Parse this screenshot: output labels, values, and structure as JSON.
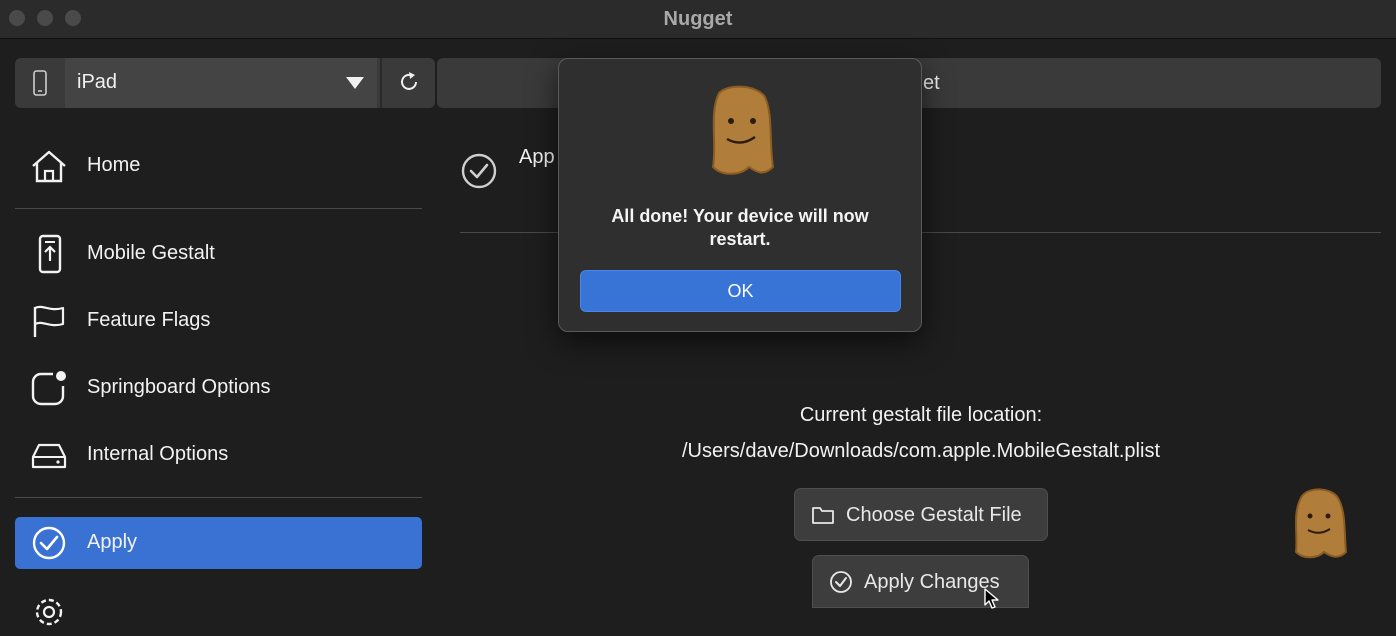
{
  "window": {
    "title": "Nugget"
  },
  "device_bar": {
    "selected_device": "iPad"
  },
  "top_field": {
    "text": "et"
  },
  "sidebar": {
    "items": [
      {
        "label": "Home",
        "icon": "home-icon"
      },
      {
        "label": "Mobile Gestalt",
        "icon": "phone-upload-icon"
      },
      {
        "label": "Feature Flags",
        "icon": "flag-icon"
      },
      {
        "label": "Springboard Options",
        "icon": "app-badge-icon"
      },
      {
        "label": "Internal Options",
        "icon": "drive-icon"
      },
      {
        "label": "Apply",
        "icon": "checkmark-circle-icon",
        "active": true
      }
    ]
  },
  "main": {
    "title": "App",
    "location_label": "Current gestalt file location:",
    "location_path": "/Users/dave/Downloads/com.apple.MobileGestalt.plist",
    "choose_button": "Choose Gestalt File",
    "apply_button": "Apply Changes"
  },
  "dialog": {
    "message": "All done! Your device will now restart.",
    "ok_label": "OK"
  },
  "colors": {
    "accent": "#3a72d4",
    "background": "#1e1e1e",
    "panel": "#3a3a3a"
  }
}
